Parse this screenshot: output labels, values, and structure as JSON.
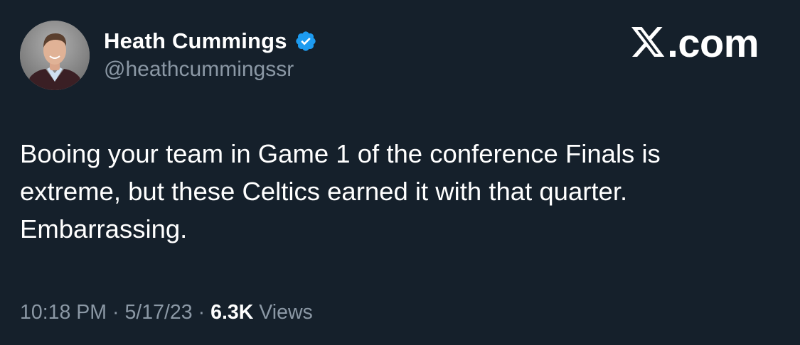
{
  "author": {
    "display_name": "Heath Cummings",
    "handle": "@heathcummingssr",
    "verified_icon": "verified-badge-icon",
    "avatar": "profile-photo"
  },
  "brand": {
    "logo_icon": "x-logo-icon",
    "text": ".com"
  },
  "tweet": {
    "lines": [
      "Booing your team in Game 1 of the conference Finals is",
      "extreme, but these Celtics earned it with that quarter.",
      "Embarrassing."
    ]
  },
  "meta": {
    "time": "10:18 PM",
    "separator": "·",
    "date": "5/17/23",
    "views_count": "6.3K",
    "views_label": "Views"
  },
  "colors": {
    "background": "#15202b",
    "text_primary": "#ffffff",
    "text_secondary": "#8b98a5",
    "verified": "#1d9bf0"
  }
}
